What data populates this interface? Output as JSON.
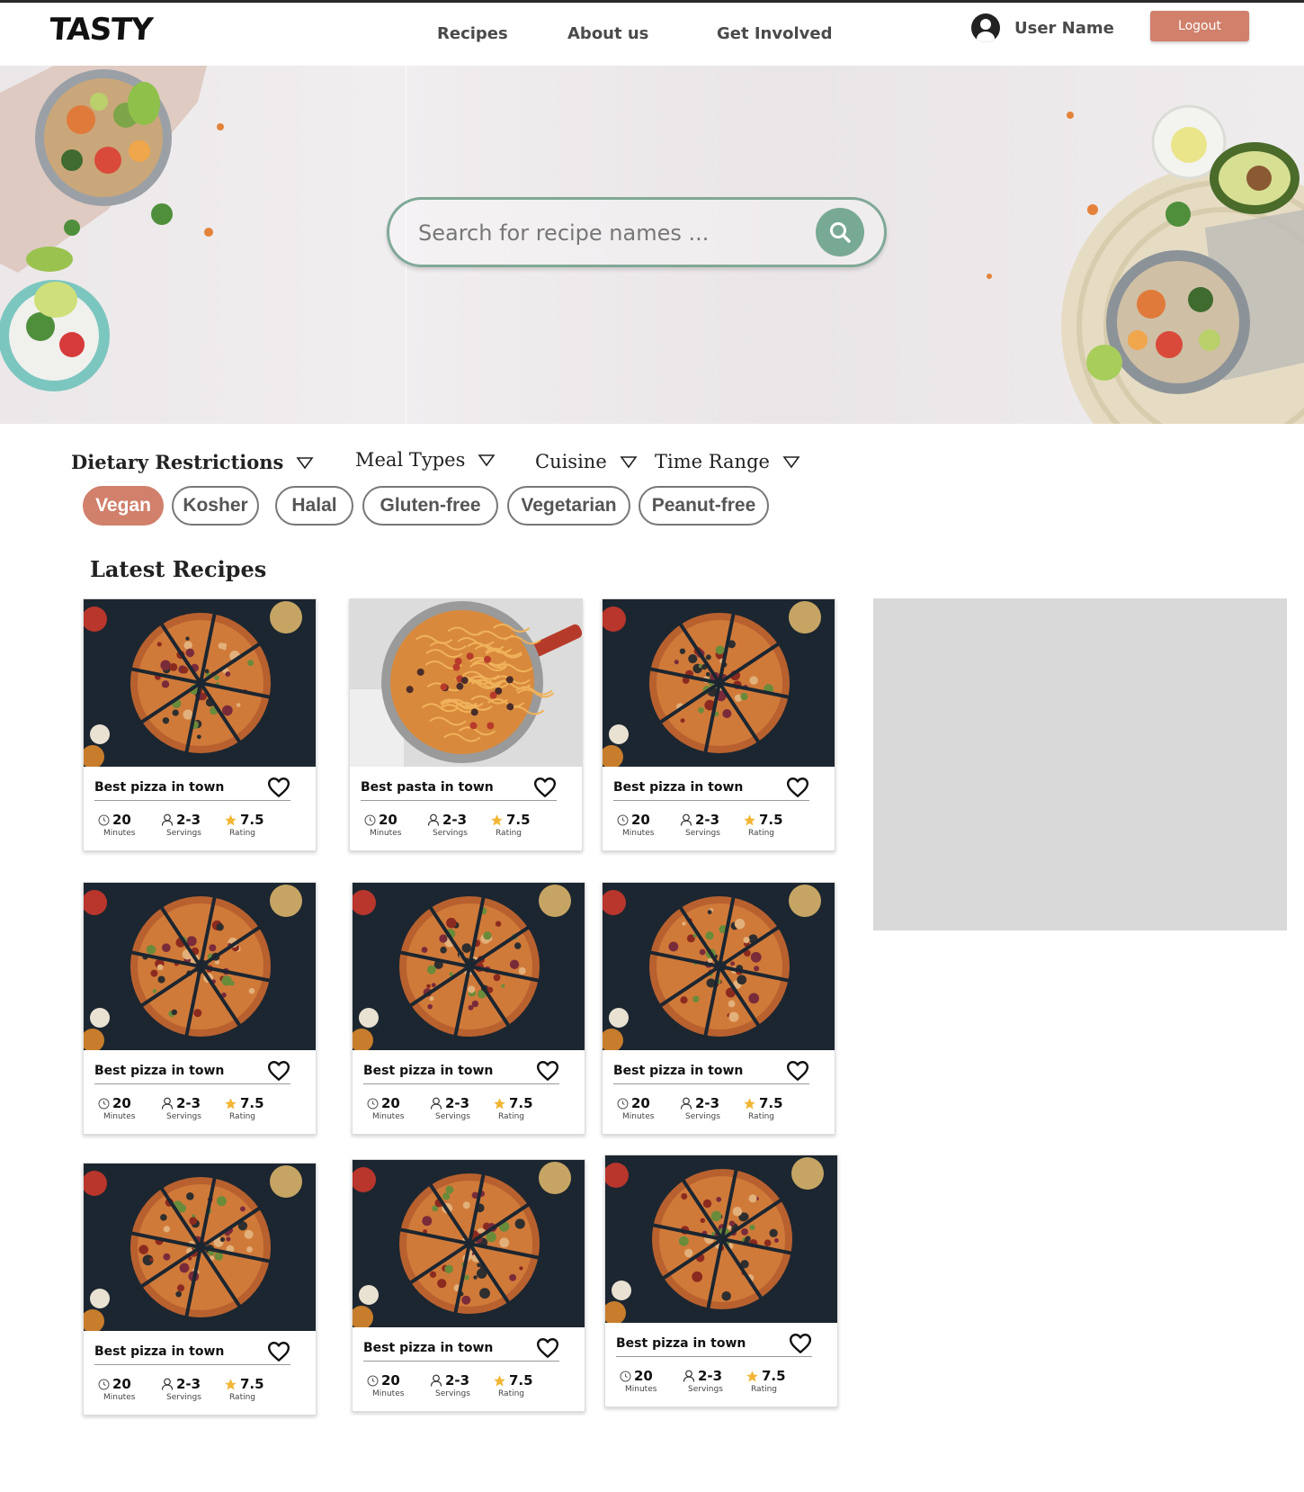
{
  "brand": {
    "logo_text": "TASTY"
  },
  "nav": {
    "items": [
      {
        "label": "Recipes"
      },
      {
        "label": "About us"
      },
      {
        "label": "Get Involved"
      }
    ]
  },
  "user": {
    "name": "User Name",
    "logout_label": "Logout"
  },
  "search": {
    "placeholder": "Search for recipe names ..."
  },
  "filters": [
    {
      "label": "Dietary Restrictions"
    },
    {
      "label": "Meal Types"
    },
    {
      "label": "Cuisine"
    },
    {
      "label": "Time Range"
    }
  ],
  "chips": [
    {
      "label": "Vegan",
      "active": true
    },
    {
      "label": "Kosher",
      "active": false
    },
    {
      "label": "Halal",
      "active": false
    },
    {
      "label": "Gluten-free",
      "active": false
    },
    {
      "label": "Vegetarian",
      "active": false
    },
    {
      "label": "Peanut-free",
      "active": false
    }
  ],
  "latest": {
    "title": "Latest Recipes",
    "stat_captions": {
      "time": "Minutes",
      "servings": "Servings",
      "rating": "Rating"
    },
    "cards": [
      {
        "title": "Best pizza in town",
        "image": "pizza",
        "minutes": "20",
        "servings": "2-3",
        "rating": "7.5"
      },
      {
        "title": "Best pasta in town",
        "image": "pasta",
        "minutes": "20",
        "servings": "2-3",
        "rating": "7.5"
      },
      {
        "title": "Best pizza in town",
        "image": "pizza",
        "minutes": "20",
        "servings": "2-3",
        "rating": "7.5"
      },
      {
        "title": "Best pizza in town",
        "image": "pizza",
        "minutes": "20",
        "servings": "2-3",
        "rating": "7.5"
      },
      {
        "title": "Best pizza in town",
        "image": "pizza",
        "minutes": "20",
        "servings": "2-3",
        "rating": "7.5"
      },
      {
        "title": "Best pizza in town",
        "image": "pizza",
        "minutes": "20",
        "servings": "2-3",
        "rating": "7.5"
      },
      {
        "title": "Best pizza in town",
        "image": "pizza",
        "minutes": "20",
        "servings": "2-3",
        "rating": "7.5"
      },
      {
        "title": "Best pizza in town",
        "image": "pizza",
        "minutes": "20",
        "servings": "2-3",
        "rating": "7.5"
      },
      {
        "title": "Best pizza in town",
        "image": "pizza",
        "minutes": "20",
        "servings": "2-3",
        "rating": "7.5"
      }
    ]
  },
  "colors": {
    "accent": "#d0806b",
    "search_green": "#78a994",
    "ad_gray": "#d9d9d9"
  }
}
